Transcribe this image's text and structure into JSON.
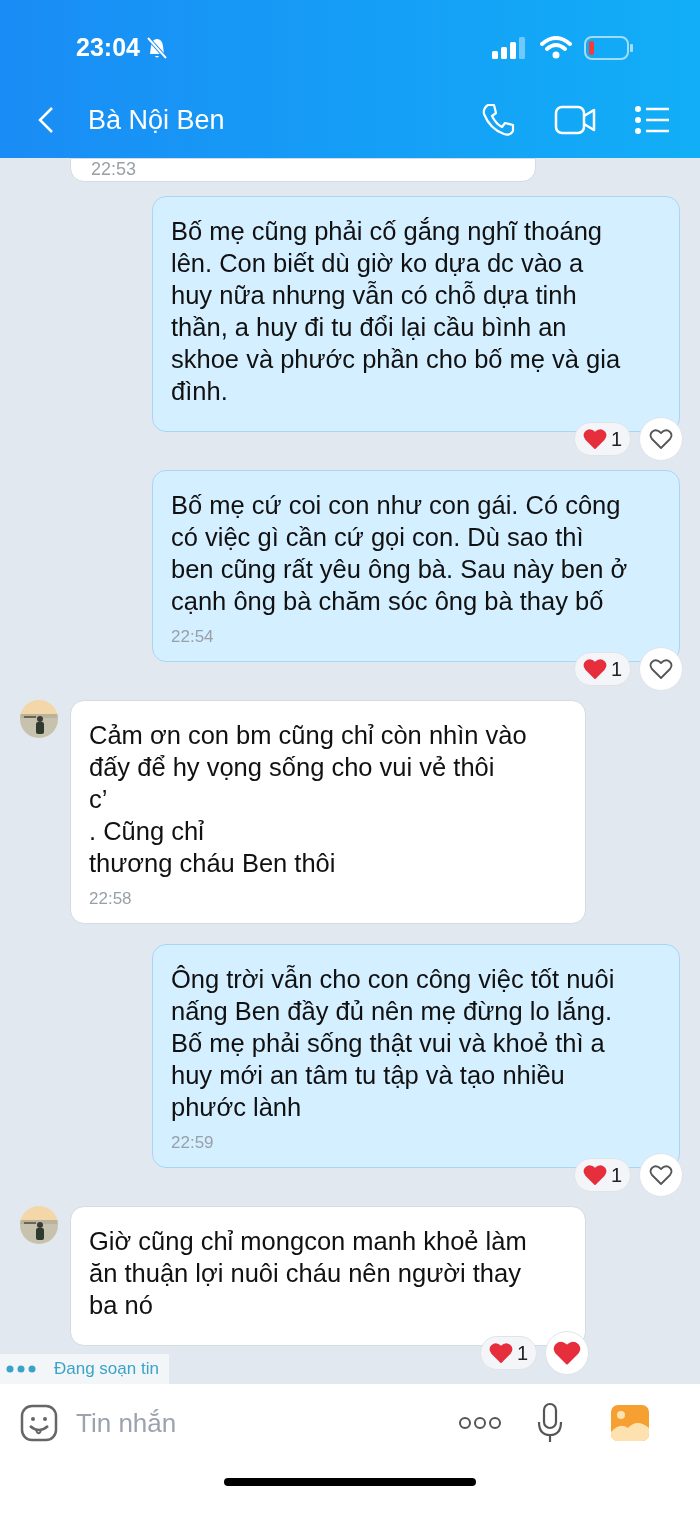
{
  "status_bar": {
    "time": "23:04",
    "muted": true
  },
  "header": {
    "title": "Bà Nội Ben"
  },
  "messages": [
    {
      "kind": "partial",
      "time": "22:53"
    },
    {
      "kind": "outgoing",
      "lines": [
        "Bố mẹ cũng phải cố gắng nghĩ thoáng",
        "lên. Con biết dù giờ ko dựa dc vào a",
        "huy nữa nhưng vẫn có chỗ dựa tinh",
        "thần, a huy đi tu đổi lại cầu bình an",
        "skhoe và phước phần cho bố mẹ và gia",
        "đình."
      ],
      "reaction_count": "1",
      "my_reaction": false
    },
    {
      "kind": "outgoing",
      "lines": [
        "Bố mẹ cứ coi con như con gái. Có công",
        "có việc gì cần cứ gọi con. Dù sao thì",
        "ben cũng rất yêu ông bà. Sau này ben ở",
        "cạnh ông bà chăm sóc ông bà thay bố"
      ],
      "time": "22:54",
      "reaction_count": "1",
      "my_reaction": false
    },
    {
      "kind": "incoming",
      "avatar": true,
      "lines": [
        "Cảm ơn con bm cũng chỉ còn nhìn vào",
        "đấy để hy vọng sống cho vui vẻ thôi",
        "c’",
        ". Cũng chỉ",
        "thương cháu Ben thôi"
      ],
      "time": "22:58"
    },
    {
      "kind": "outgoing",
      "lines": [
        "Ông trời vẫn cho con công việc tốt nuôi",
        "nấng Ben đầy đủ nên mẹ đừng lo lắng.",
        "Bố mẹ phải sống thật vui và khoẻ thì a",
        "huy mới an tâm tu tập và tạo nhiều",
        "phước lành"
      ],
      "time": "22:59",
      "reaction_count": "1",
      "my_reaction": false
    },
    {
      "kind": "incoming",
      "avatar": true,
      "lines": [
        "Giờ cũng chỉ mongcon manh khoẻ làm",
        "ăn thuận lợi nuôi cháu nên người thay",
        "ba nó"
      ],
      "reaction_count": "1",
      "my_reaction": true
    }
  ],
  "typing": {
    "label": "Đang soạn tin"
  },
  "composer": {
    "placeholder": "Tin nhắn"
  }
}
